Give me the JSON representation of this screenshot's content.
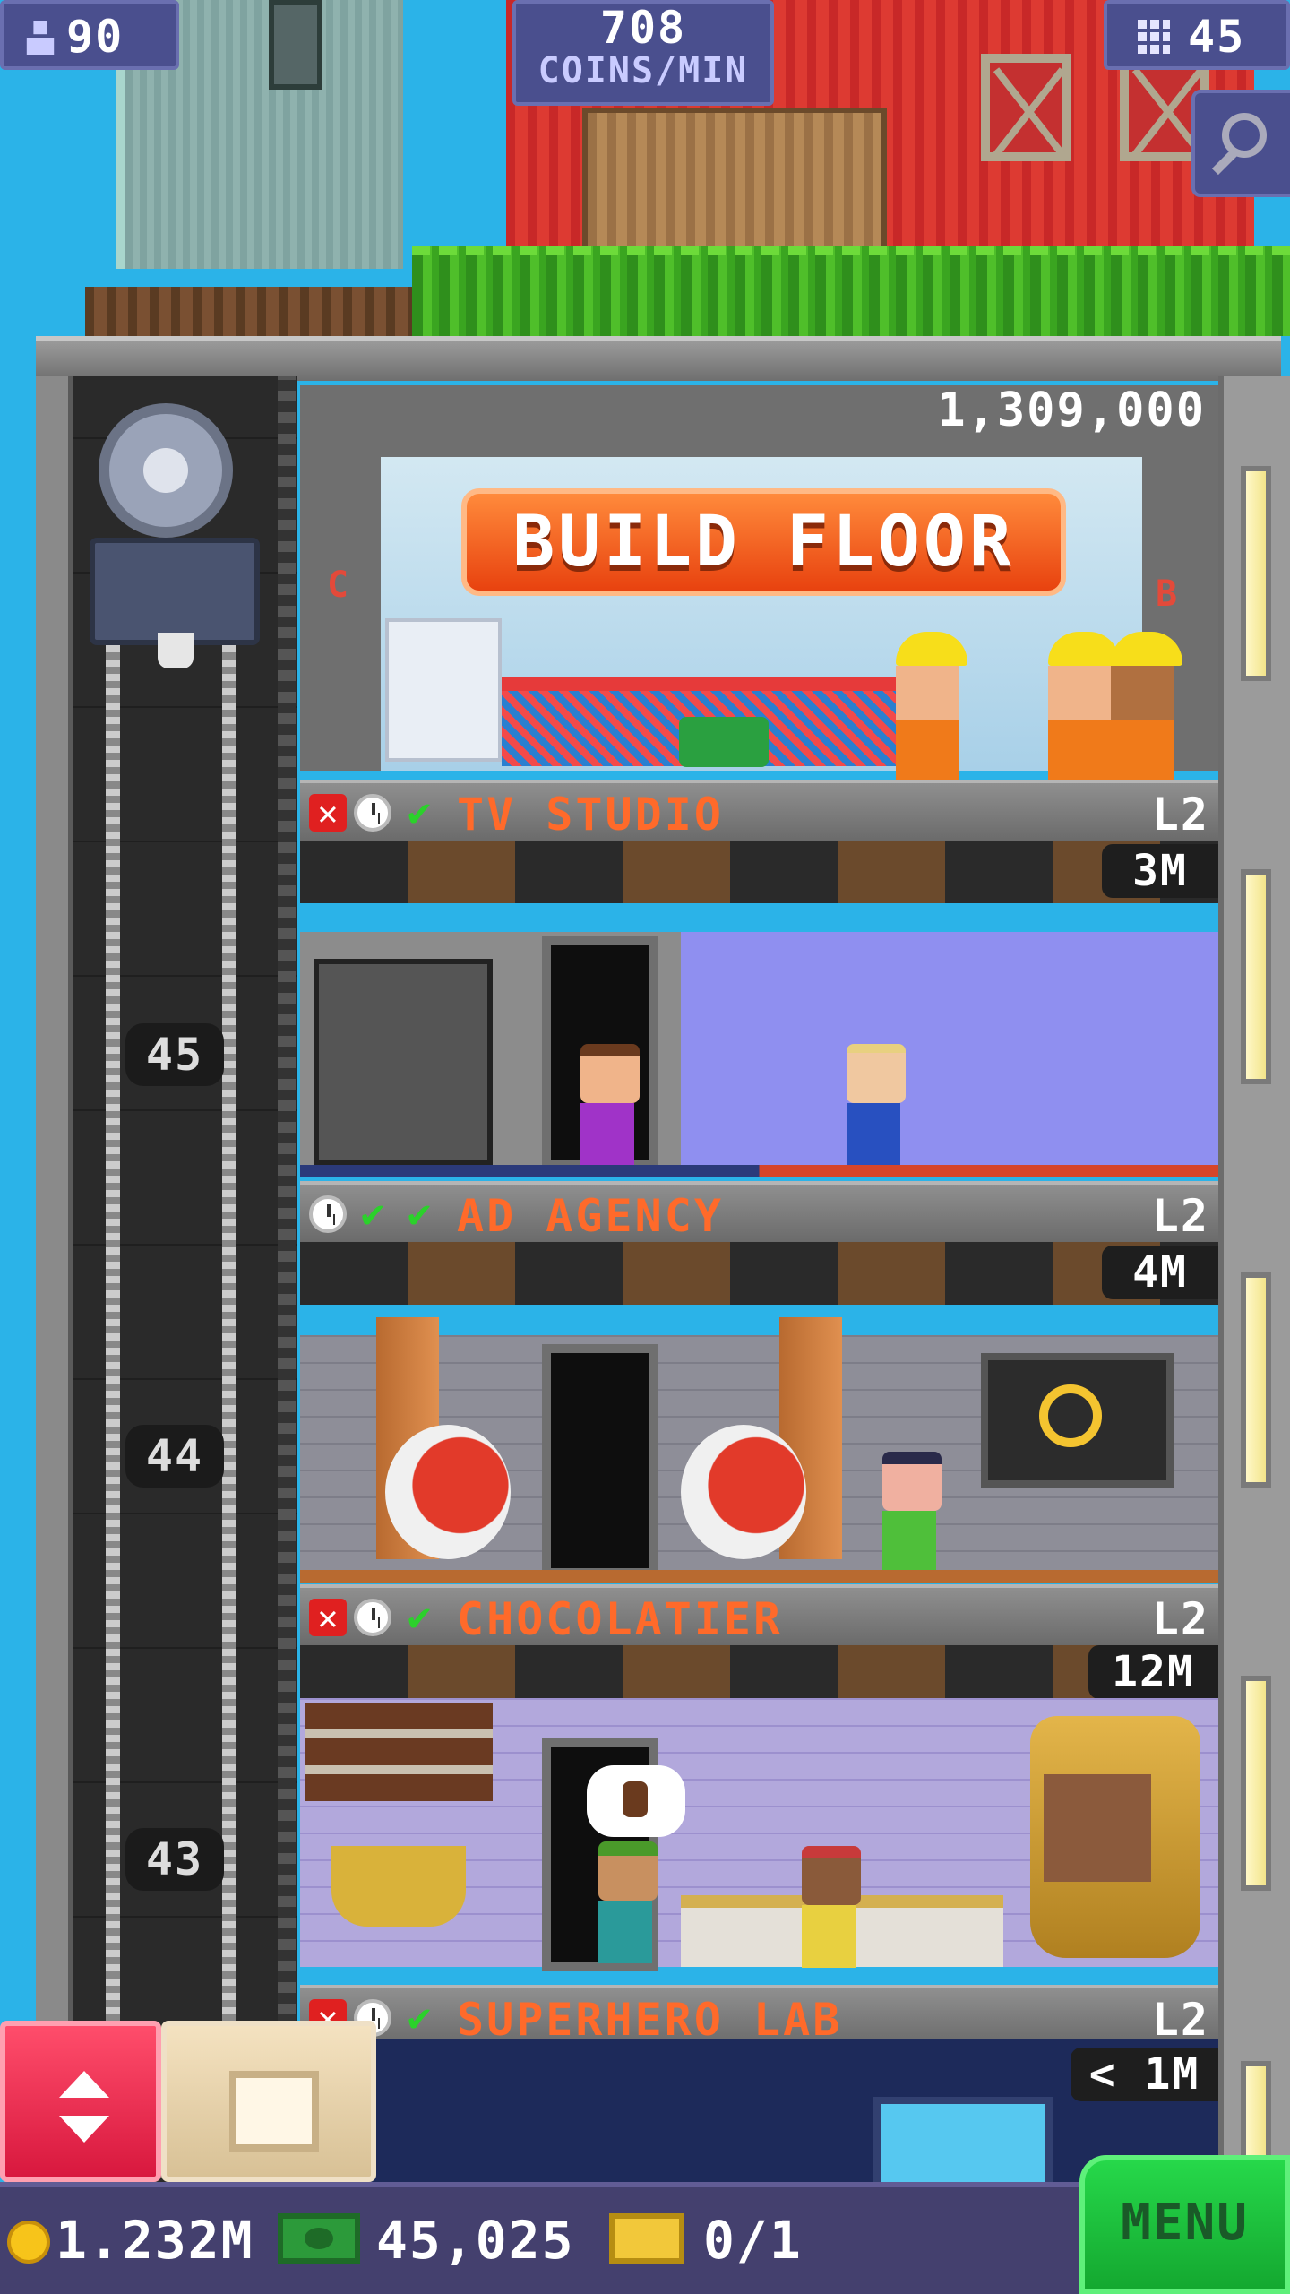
{
  "hud": {
    "population": "90",
    "rate_value": "708",
    "rate_label": "COINS/MIN",
    "floors": "45",
    "icons": [
      "person-icon",
      "building-icon",
      "magnifier-icon"
    ]
  },
  "build": {
    "cost": "1,309,000",
    "button_label": "BUILD FLOOR",
    "side_left": "C",
    "side_right": "B"
  },
  "floors": [
    {
      "name": "TV STUDIO",
      "level": "L2",
      "cost": "3M",
      "status": [
        "x",
        "clock",
        "check"
      ]
    },
    {
      "name": "AD AGENCY",
      "level": "L2",
      "cost": "4M",
      "status": [
        "clock",
        "check",
        "check"
      ]
    },
    {
      "name": "CHOCOLATIER",
      "level": "L2",
      "cost": "12M",
      "status": [
        "x",
        "clock",
        "check"
      ]
    },
    {
      "name": "SUPERHERO LAB",
      "level": "L2",
      "cost": "< 1M",
      "status": [
        "x",
        "clock",
        "check"
      ]
    }
  ],
  "shaft_numbers": [
    "45",
    "44",
    "43"
  ],
  "bottom": {
    "coins": "1.232M",
    "bux": "45,025",
    "tickets": "0/1",
    "menu": "MENU"
  },
  "colors": {
    "accent_orange": "#ff6a2a",
    "menu_green": "#1fc23c",
    "lift_red": "#e8264a",
    "hud_purple": "#4a4f8e"
  }
}
